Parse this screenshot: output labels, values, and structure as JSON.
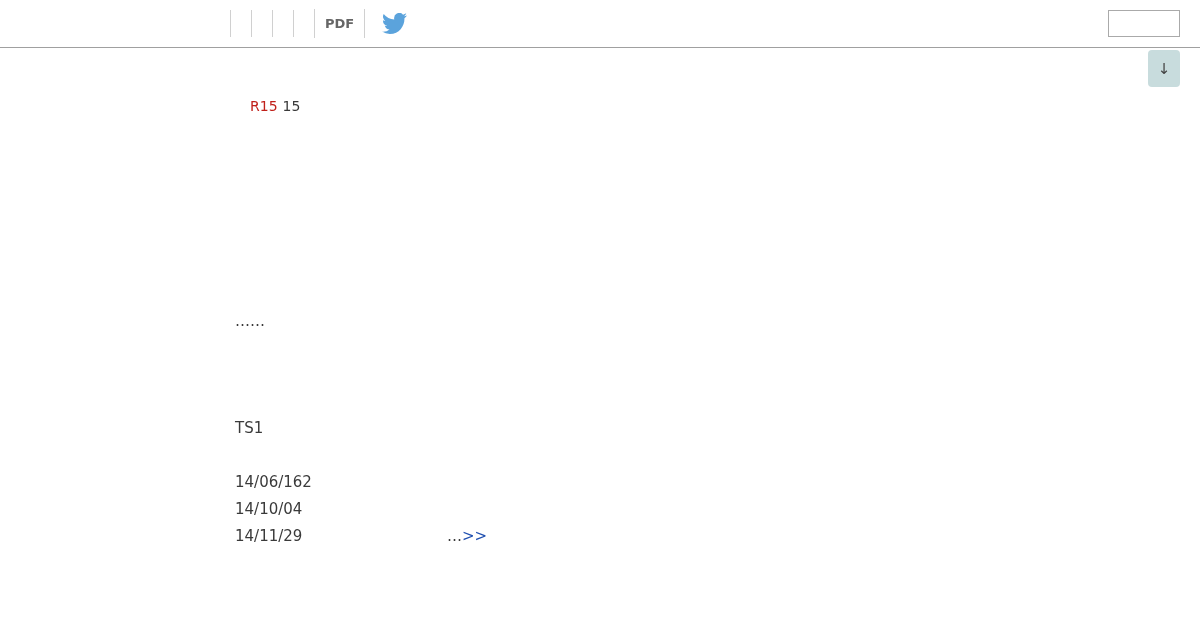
{
  "toolbar": {
    "pdf_link": "PDF"
  },
  "scroll_button": {
    "label": "↓"
  },
  "content": {
    "tag": "R15",
    "tag_text": "15",
    "ellipsis": "……",
    "code": "TS1",
    "dates": [
      "14/06/162",
      "14/10/04",
      "14/11/29"
    ],
    "more": {
      "text": "…",
      "link": ">>"
    }
  }
}
